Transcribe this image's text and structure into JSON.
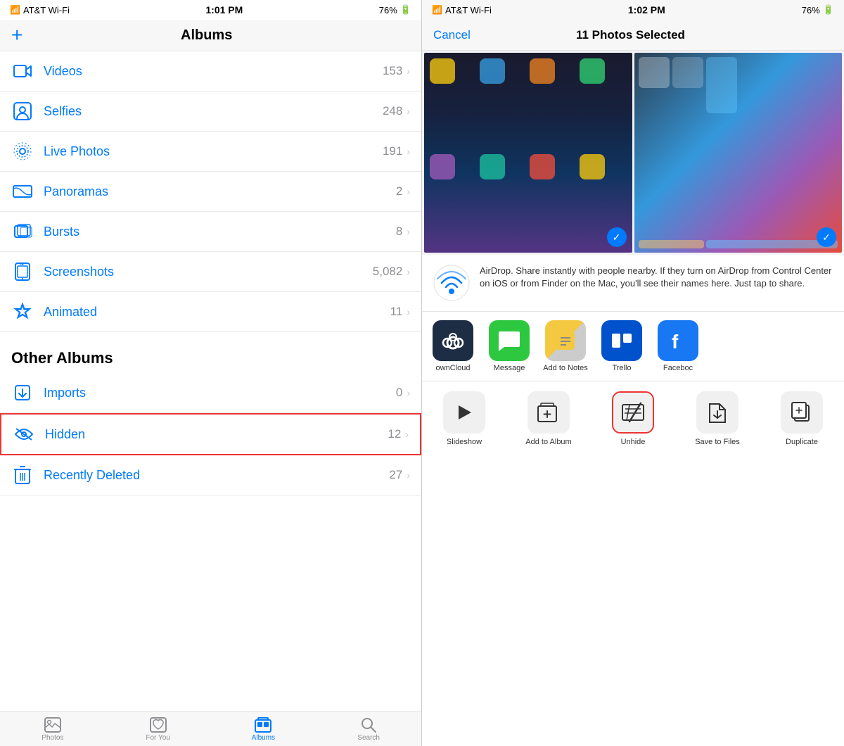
{
  "left": {
    "statusBar": {
      "carrier": "AT&T Wi-Fi",
      "time": "1:01 PM",
      "battery": "76%"
    },
    "navBar": {
      "addLabel": "+",
      "title": "Albums"
    },
    "albums": [
      {
        "id": "videos",
        "icon": "video",
        "name": "Videos",
        "count": "153"
      },
      {
        "id": "selfies",
        "icon": "selfie",
        "name": "Selfies",
        "count": "248"
      },
      {
        "id": "live-photos",
        "icon": "live",
        "name": "Live Photos",
        "count": "191"
      },
      {
        "id": "panoramas",
        "icon": "panorama",
        "name": "Panoramas",
        "count": "2"
      },
      {
        "id": "bursts",
        "icon": "bursts",
        "name": "Bursts",
        "count": "8"
      },
      {
        "id": "screenshots",
        "icon": "screenshot",
        "name": "Screenshots",
        "count": "5,082"
      },
      {
        "id": "animated",
        "icon": "animated",
        "name": "Animated",
        "count": "11"
      }
    ],
    "otherAlbumsHeader": "Other Albums",
    "otherAlbums": [
      {
        "id": "imports",
        "icon": "imports",
        "name": "Imports",
        "count": "0"
      },
      {
        "id": "hidden",
        "icon": "hidden",
        "name": "Hidden",
        "count": "12",
        "highlighted": true
      },
      {
        "id": "recently-deleted",
        "icon": "trash",
        "name": "Recently Deleted",
        "count": "27"
      }
    ],
    "tabs": [
      {
        "id": "photos",
        "label": "Photos",
        "icon": "photo",
        "active": false
      },
      {
        "id": "for-you",
        "label": "For You",
        "icon": "heart",
        "active": false
      },
      {
        "id": "albums",
        "label": "Albums",
        "icon": "album",
        "active": true
      },
      {
        "id": "search",
        "label": "Search",
        "icon": "search",
        "active": false
      }
    ]
  },
  "right": {
    "statusBar": {
      "carrier": "AT&T Wi-Fi",
      "time": "1:02 PM",
      "battery": "76%"
    },
    "navBar": {
      "cancelLabel": "Cancel",
      "title": "11 Photos Selected"
    },
    "airdrop": {
      "title": "AirDrop",
      "description": "AirDrop. Share instantly with people nearby. If they turn on AirDrop from Control Center on iOS or from Finder on the Mac, you'll see their names here. Just tap to share."
    },
    "shareApps": [
      {
        "id": "owncloud",
        "label": "ownCloud",
        "colorClass": "owncloud"
      },
      {
        "id": "message",
        "label": "Message",
        "colorClass": "message"
      },
      {
        "id": "add-to-notes",
        "label": "Add to Notes",
        "colorClass": "addnotes"
      },
      {
        "id": "trello",
        "label": "Trello",
        "colorClass": "trello"
      },
      {
        "id": "facebook",
        "label": "Faceboc",
        "colorClass": "facebook"
      }
    ],
    "actions": [
      {
        "id": "slideshow",
        "label": "Slideshow",
        "icon": "play"
      },
      {
        "id": "add-to-album",
        "label": "Add to Album",
        "icon": "add-album"
      },
      {
        "id": "unhide",
        "label": "Unhide",
        "icon": "unhide",
        "highlighted": true
      },
      {
        "id": "save-to-files",
        "label": "Save to Files",
        "icon": "save-files"
      },
      {
        "id": "duplicate",
        "label": "Duplicate",
        "icon": "duplicate"
      }
    ]
  }
}
